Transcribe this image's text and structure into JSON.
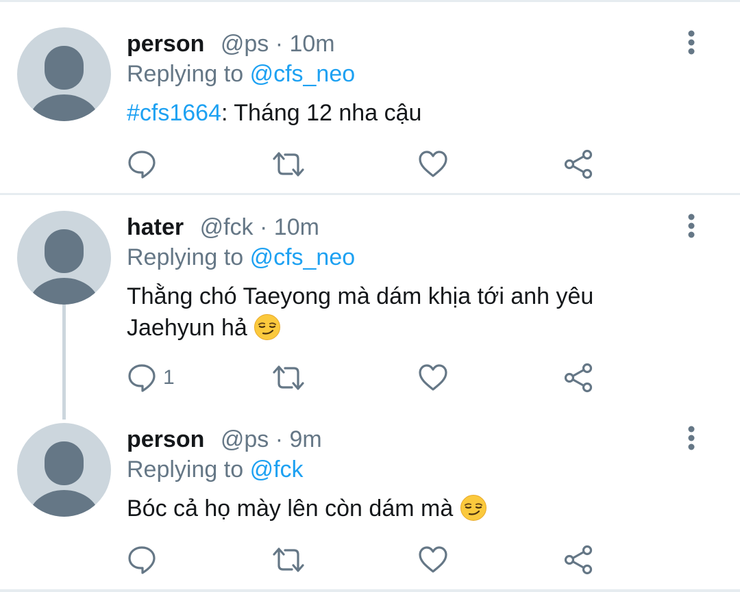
{
  "tweets": [
    {
      "name": "person",
      "handle": "@ps",
      "separator": "·",
      "time": "10m",
      "replying_prefix": "Replying to",
      "replying_to": "@cfs_neo",
      "hashtag": "#cfs1664",
      "text": ": Tháng 12 nha cậu",
      "reply_count": ""
    },
    {
      "name": "hater",
      "handle": "@fck",
      "separator": "·",
      "time": "10m",
      "replying_prefix": "Replying to",
      "replying_to": "@cfs_neo",
      "text_line1": "Thằng chó Taeyong mà dám khịa tới anh yêu",
      "text_line2": "Jaehyun hả",
      "emoji": "smirking-face",
      "reply_count": "1"
    },
    {
      "name": "person",
      "handle": "@ps",
      "separator": "·",
      "time": "9m",
      "replying_prefix": "Replying to",
      "replying_to": "@fck",
      "text": "Bóc cả họ mày lên còn dám mà",
      "emoji": "smirking-face",
      "reply_count": ""
    }
  ],
  "icons": {
    "reply": "reply-icon",
    "retweet": "retweet-icon",
    "like": "heart-icon",
    "share": "share-icon",
    "more": "more-vertical-icon"
  },
  "colors": {
    "text": "#14171a",
    "secondary": "#657786",
    "link": "#1da1f2",
    "avatar_bg": "#ccd6dd",
    "avatar_fg": "#657786",
    "divider": "#e6ecf0"
  }
}
